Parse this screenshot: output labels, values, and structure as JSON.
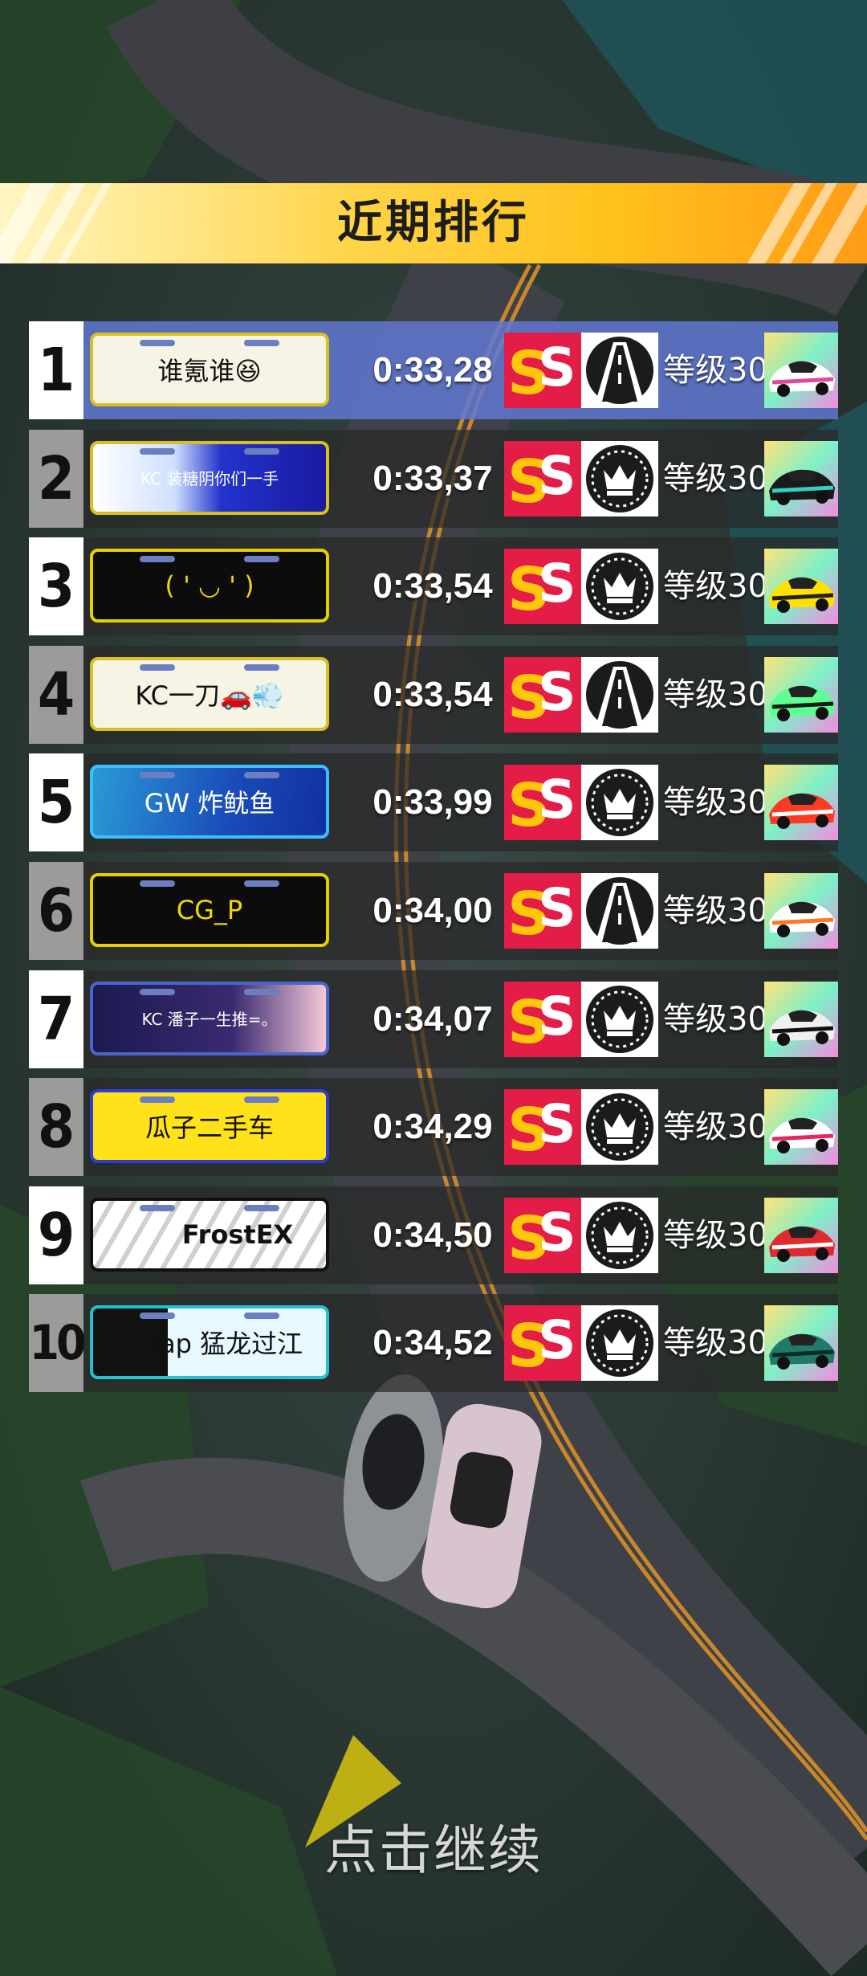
{
  "header": {
    "title": "近期排行"
  },
  "leaderboard": [
    {
      "rank": "1",
      "plate": "谁氪谁😆",
      "time": "0:33,28",
      "track_icon": "track-road-icon",
      "level": "等级30",
      "car_colors": [
        "#ffffff",
        "#e0489a"
      ],
      "highlight": true
    },
    {
      "rank": "2",
      "plate": "KC 装糖阴你们一手",
      "time": "0:33,37",
      "track_icon": "crown-icon",
      "level": "等级30",
      "car_colors": [
        "#1a1a1a",
        "#33d0c0"
      ],
      "highlight": false
    },
    {
      "rank": "3",
      "plate": "( ' ◡ ' )",
      "time": "0:33,54",
      "track_icon": "crown-icon",
      "level": "等级30",
      "car_colors": [
        "#ffe000",
        "#222222"
      ],
      "highlight": false
    },
    {
      "rank": "4",
      "plate": "KC一刀🚗💨",
      "time": "0:33,54",
      "track_icon": "track-road-icon",
      "level": "等级30",
      "car_colors": [
        "#5cff90",
        "#1b1b1b"
      ],
      "highlight": false
    },
    {
      "rank": "5",
      "plate": "GW 炸鱿鱼",
      "time": "0:33,99",
      "track_icon": "crown-icon",
      "level": "等级30",
      "car_colors": [
        "#ff3a22",
        "#ffffff"
      ],
      "highlight": false
    },
    {
      "rank": "6",
      "plate": "CG_P",
      "time": "0:34,00",
      "track_icon": "track-road-icon",
      "level": "等级30",
      "car_colors": [
        "#ffffff",
        "#ff7722"
      ],
      "highlight": false
    },
    {
      "rank": "7",
      "plate": "KC 潘子一生推=。",
      "time": "0:34,07",
      "track_icon": "crown-icon",
      "level": "等级30",
      "car_colors": [
        "#f0f0f0",
        "#111111"
      ],
      "highlight": false
    },
    {
      "rank": "8",
      "plate": "瓜子二手车",
      "time": "0:34,29",
      "track_icon": "crown-icon",
      "level": "等级30",
      "car_colors": [
        "#ffffff",
        "#e02a60"
      ],
      "highlight": false
    },
    {
      "rank": "9",
      "plate": "FrostEX",
      "time": "0:34,50",
      "track_icon": "crown-icon",
      "level": "等级30",
      "car_colors": [
        "#e02a30",
        "#ffffff"
      ],
      "highlight": false
    },
    {
      "rank": "10",
      "plate": "Tap 猛龙过江",
      "time": "0:34,52",
      "track_icon": "crown-icon",
      "level": "等级30",
      "car_colors": [
        "#1f7a6a",
        "#0a2a28"
      ],
      "highlight": false
    }
  ],
  "footer": {
    "continue_label": "点击继续"
  },
  "colors": {
    "banner": "#ffc21c",
    "rank_badge": "#e41c48",
    "highlight_row": "#6078d2"
  }
}
